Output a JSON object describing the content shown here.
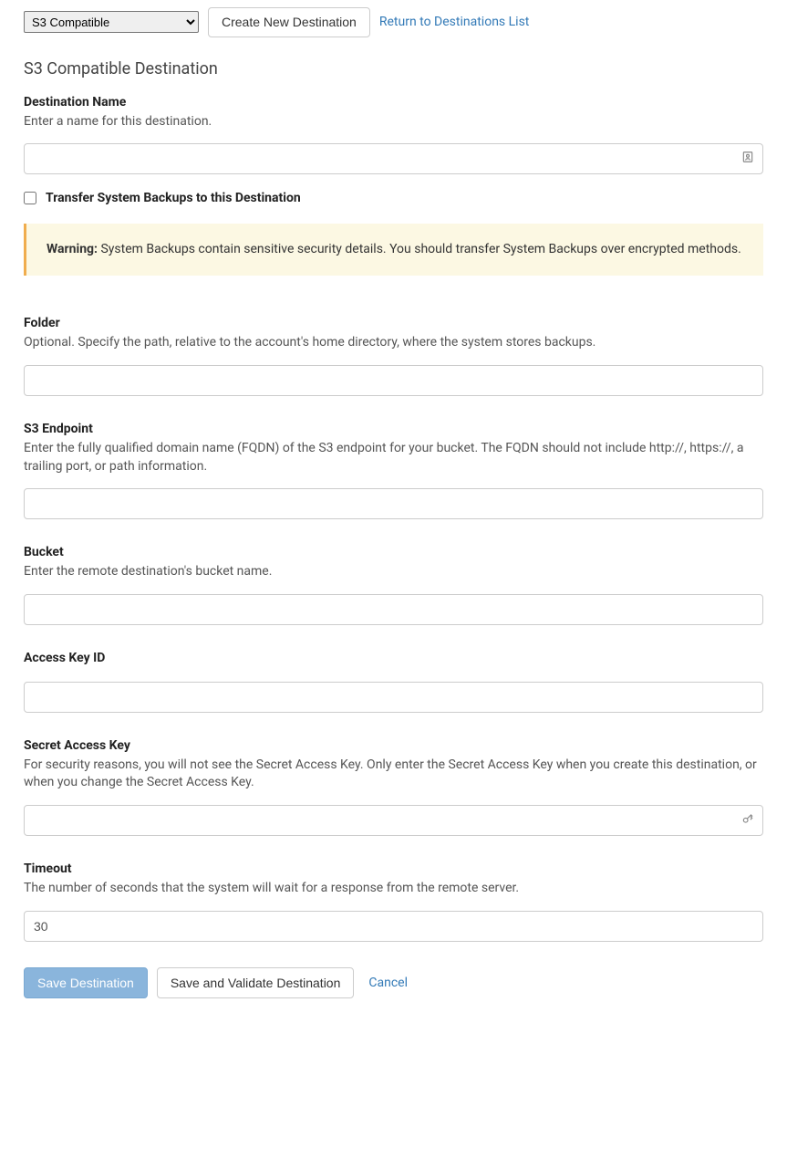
{
  "top": {
    "select_value": "S3 Compatible",
    "create_button": "Create New Destination",
    "return_link": "Return to Destinations List"
  },
  "title": "S3 Compatible Destination",
  "fields": {
    "name": {
      "label": "Destination Name",
      "help": "Enter a name for this destination.",
      "value": ""
    },
    "transfer_backups": {
      "label": "Transfer System Backups to this Destination",
      "checked": false
    },
    "warning": {
      "prefix": "Warning:",
      "text": " System Backups contain sensitive security details. You should transfer System Backups over encrypted methods."
    },
    "folder": {
      "label": "Folder",
      "help": "Optional. Specify the path, relative to the account's home directory, where the system stores backups.",
      "value": ""
    },
    "endpoint": {
      "label": "S3 Endpoint",
      "help": "Enter the fully qualified domain name (FQDN) of the S3 endpoint for your bucket. The FQDN should not include http://, https://, a trailing port, or path information.",
      "value": ""
    },
    "bucket": {
      "label": "Bucket",
      "help": "Enter the remote destination's bucket name.",
      "value": ""
    },
    "access_key": {
      "label": "Access Key ID",
      "value": ""
    },
    "secret_key": {
      "label": "Secret Access Key",
      "help": "For security reasons, you will not see the Secret Access Key. Only enter the Secret Access Key when you create this destination, or when you change the Secret Access Key.",
      "value": ""
    },
    "timeout": {
      "label": "Timeout",
      "help": "The number of seconds that the system will wait for a response from the remote server.",
      "value": "30"
    }
  },
  "buttons": {
    "save": "Save Destination",
    "save_validate": "Save and Validate Destination",
    "cancel": "Cancel"
  }
}
